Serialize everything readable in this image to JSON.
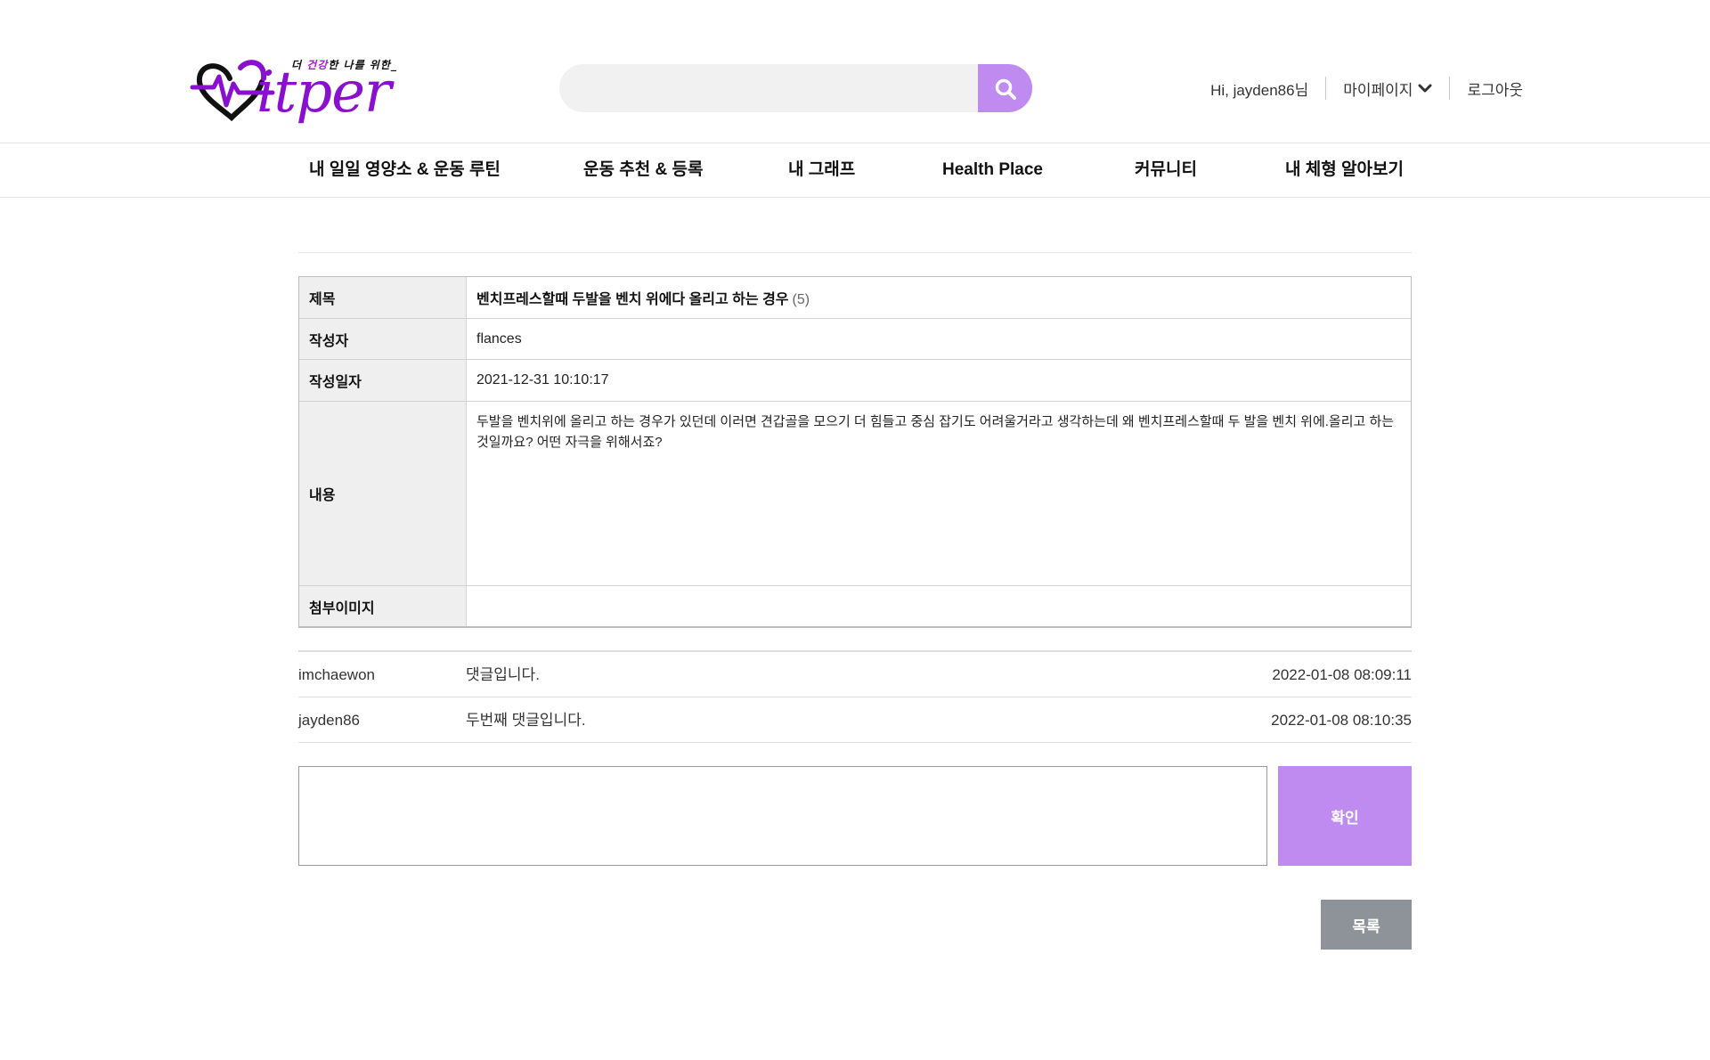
{
  "header": {
    "logo_tagline_prefix": "더 ",
    "logo_tagline_highlight": "건강",
    "logo_tagline_suffix": "한 나를 위한_",
    "logo_text": "itper",
    "search_placeholder": "",
    "search_value": "",
    "greeting": "Hi, jayden86님",
    "mypage_label": "마이페이지",
    "logout_label": "로그아웃"
  },
  "nav": {
    "items": [
      {
        "label": "내 일일 영양소 & 운동 루틴"
      },
      {
        "label": "운동 추천 & 등록"
      },
      {
        "label": "내 그래프"
      },
      {
        "label": "Health Place"
      },
      {
        "label": "커뮤니티"
      },
      {
        "label": "내 체형 알아보기"
      }
    ]
  },
  "post": {
    "title_label": "제목",
    "title": "벤치프레스할때 두발을 벤치 위에다 올리고 하는 경우",
    "title_count": "(5)",
    "author_label": "작성자",
    "author": "flances",
    "date_label": "작성일자",
    "date": "2021-12-31 10:10:17",
    "content_label": "내용",
    "content": "두발을 벤치위에 올리고 하는 경우가 있던데 이러면 견갑골을 모으기 더 힘들고 중심 잡기도 어려울거라고 생각하는데 왜 벤치프레스할때 두 발을 벤치 위에.올리고 하는 것일까요? 어떤 자극을 위해서죠?",
    "image_label": "첨부이미지"
  },
  "comments": [
    {
      "author": "imchaewon",
      "text": "댓글입니다.",
      "date": "2022-01-08 08:09:11"
    },
    {
      "author": "jayden86",
      "text": "두번째 댓글입니다.",
      "date": "2022-01-08 08:10:35"
    }
  ],
  "comment_form": {
    "value": "",
    "confirm_label": "확인"
  },
  "list_button_label": "목록",
  "colors": {
    "accent": "#c08bf0",
    "logo_purple": "#8a10d0",
    "list_button": "#8e9399"
  },
  "icons": {
    "search": "search-icon",
    "mypage_dropdown": "chevron-down-icon",
    "logo": "heart-logo-icon"
  }
}
